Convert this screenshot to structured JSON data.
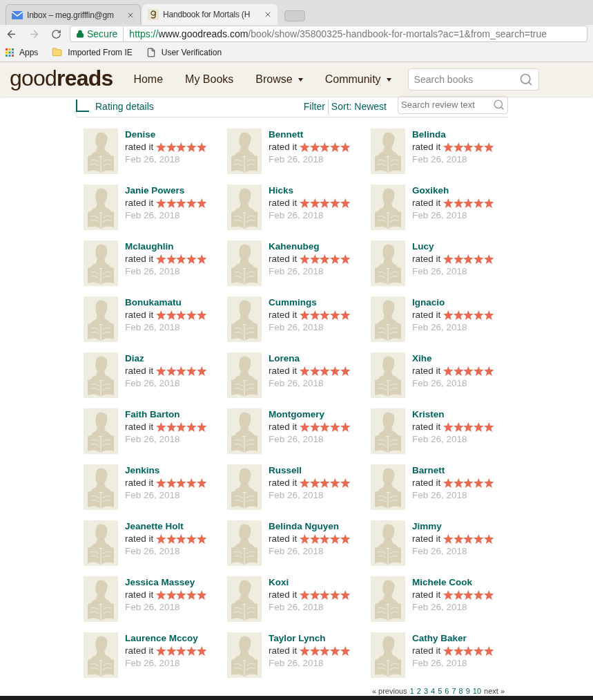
{
  "browser": {
    "tabs": [
      {
        "title": "Inbox – meg.grifffin@gm",
        "kind": "mail",
        "selected": false
      },
      {
        "title": "Handbook for Mortals (H",
        "kind": "site",
        "selected": true
      }
    ],
    "address": {
      "secure_label": "Secure",
      "scheme": "https://",
      "host": "www.goodreads.com",
      "path": "/book/show/35800325-handbook-for-mortals?ac=1&from_search=true"
    },
    "bookmarks": [
      {
        "label": "Apps",
        "kind": "apps"
      },
      {
        "label": "Imported From IE",
        "kind": "folder"
      },
      {
        "label": "User Verification",
        "kind": "page"
      }
    ]
  },
  "site": {
    "logo_light": "good",
    "logo_dark": "reads",
    "nav": [
      {
        "label": "Home",
        "dropdown": false
      },
      {
        "label": "My Books",
        "dropdown": false
      },
      {
        "label": "Browse",
        "dropdown": true
      },
      {
        "label": "Community",
        "dropdown": true
      }
    ],
    "search_placeholder": "Search books"
  },
  "toolbar": {
    "rating_details": "Rating details",
    "filter": "Filter",
    "sort": "Sort: Newest",
    "search_placeholder": "Search review text"
  },
  "reviews": [
    {
      "name": "Denise",
      "action": "rated it",
      "stars": 5,
      "date": "Feb 26, 2018"
    },
    {
      "name": "Bennett",
      "action": "rated it",
      "stars": 5,
      "date": "Feb 26, 2018"
    },
    {
      "name": "Belinda",
      "action": "rated it",
      "stars": 5,
      "date": "Feb 26, 2018"
    },
    {
      "name": "Janie Powers",
      "action": "rated it",
      "stars": 5,
      "date": "Feb 26, 2018"
    },
    {
      "name": "Hicks",
      "action": "rated it",
      "stars": 5,
      "date": "Feb 26, 2018"
    },
    {
      "name": "Goxikeh",
      "action": "rated it",
      "stars": 5,
      "date": "Feb 26, 2018"
    },
    {
      "name": "Mclaughlin",
      "action": "rated it",
      "stars": 5,
      "date": "Feb 26, 2018"
    },
    {
      "name": "Kahenubeg",
      "action": "rated it",
      "stars": 5,
      "date": "Feb 26, 2018"
    },
    {
      "name": "Lucy",
      "action": "rated it",
      "stars": 5,
      "date": "Feb 26, 2018"
    },
    {
      "name": "Bonukamatu",
      "action": "rated it",
      "stars": 5,
      "date": "Feb 26, 2018"
    },
    {
      "name": "Cummings",
      "action": "rated it",
      "stars": 5,
      "date": "Feb 26, 2018"
    },
    {
      "name": "Ignacio",
      "action": "rated it",
      "stars": 5,
      "date": "Feb 26, 2018"
    },
    {
      "name": "Diaz",
      "action": "rated it",
      "stars": 5,
      "date": "Feb 26, 2018"
    },
    {
      "name": "Lorena",
      "action": "rated it",
      "stars": 5,
      "date": "Feb 26, 2018"
    },
    {
      "name": "Xihe",
      "action": "rated it",
      "stars": 5,
      "date": "Feb 26, 2018"
    },
    {
      "name": "Faith Barton",
      "action": "rated it",
      "stars": 5,
      "date": "Feb 26, 2018"
    },
    {
      "name": "Montgomery",
      "action": "rated it",
      "stars": 5,
      "date": "Feb 26, 2018"
    },
    {
      "name": "Kristen",
      "action": "rated it",
      "stars": 5,
      "date": "Feb 26, 2018"
    },
    {
      "name": "Jenkins",
      "action": "rated it",
      "stars": 5,
      "date": "Feb 26, 2018"
    },
    {
      "name": "Russell",
      "action": "rated it",
      "stars": 5,
      "date": "Feb 26, 2018"
    },
    {
      "name": "Barnett",
      "action": "rated it",
      "stars": 5,
      "date": "Feb 26, 2018"
    },
    {
      "name": "Jeanette Holt",
      "action": "rated it",
      "stars": 5,
      "date": "Feb 26, 2018"
    },
    {
      "name": "Belinda Nguyen",
      "action": "rated it",
      "stars": 5,
      "date": "Feb 26, 2018"
    },
    {
      "name": "Jimmy",
      "action": "rated it",
      "stars": 5,
      "date": "Feb 26, 2018"
    },
    {
      "name": "Jessica Massey",
      "action": "rated it",
      "stars": 5,
      "date": "Feb 26, 2018"
    },
    {
      "name": "Koxi",
      "action": "rated it",
      "stars": 5,
      "date": "Feb 26, 2018"
    },
    {
      "name": "Michele Cook",
      "action": "rated it",
      "stars": 5,
      "date": "Feb 26, 2018"
    },
    {
      "name": "Laurence Mccoy",
      "action": "rated it",
      "stars": 5,
      "date": "Feb 26, 2018"
    },
    {
      "name": "Taylor Lynch",
      "action": "rated it",
      "stars": 5,
      "date": "Feb 26, 2018"
    },
    {
      "name": "Cathy Baker",
      "action": "rated it",
      "stars": 5,
      "date": "Feb 26, 2018"
    }
  ],
  "pagination": {
    "previous": "« previous",
    "pages": [
      "1",
      "2",
      "3",
      "4",
      "5",
      "6",
      "7",
      "8",
      "9",
      "10"
    ],
    "next": "next »"
  }
}
